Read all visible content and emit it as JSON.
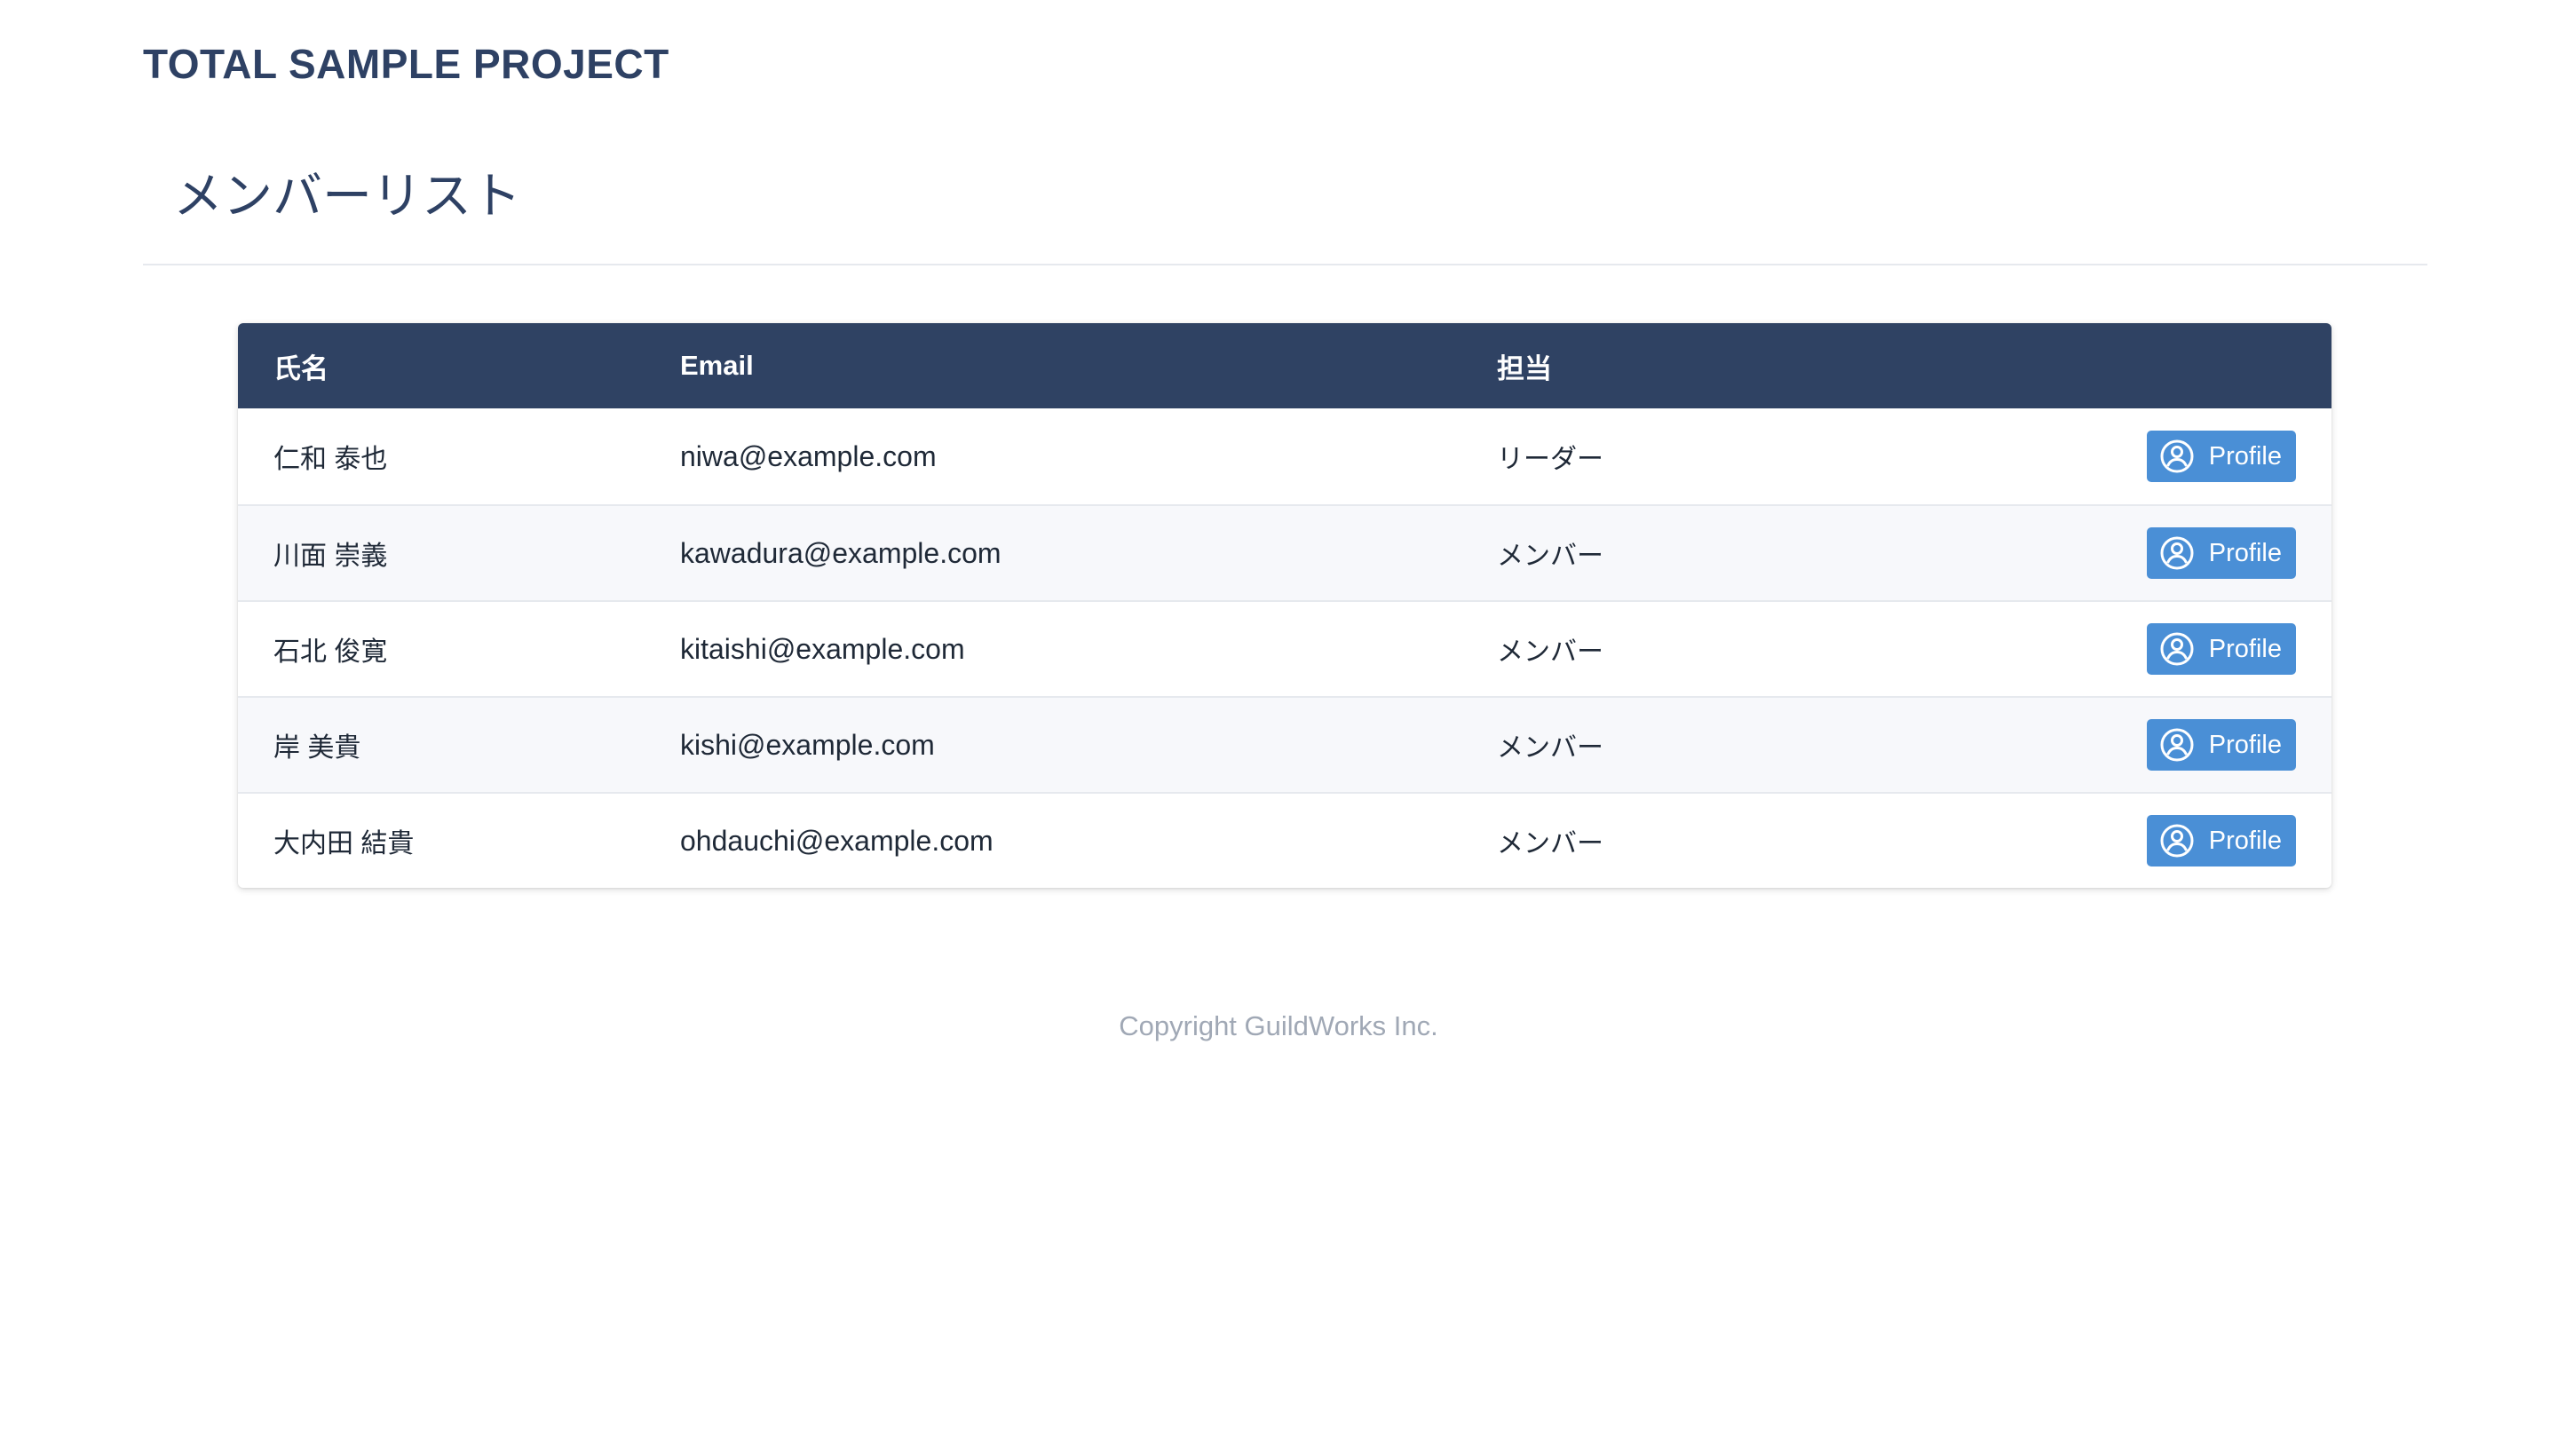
{
  "header": {
    "brand": "TOTAL SAMPLE PROJECT"
  },
  "page": {
    "title": "メンバーリスト"
  },
  "table": {
    "columns": {
      "name": "氏名",
      "email": "Email",
      "role": "担当",
      "action": ""
    },
    "rows": [
      {
        "name": "仁和 泰也",
        "email": "niwa@example.com",
        "role": "リーダー",
        "button_label": "Profile"
      },
      {
        "name": "川面 崇義",
        "email": "kawadura@example.com",
        "role": "メンバー",
        "button_label": "Profile"
      },
      {
        "name": "石北 俊寛",
        "email": "kitaishi@example.com",
        "role": "メンバー",
        "button_label": "Profile"
      },
      {
        "name": "岸 美貴",
        "email": "kishi@example.com",
        "role": "メンバー",
        "button_label": "Profile"
      },
      {
        "name": "大内田 結貴",
        "email": "ohdauchi@example.com",
        "role": "メンバー",
        "button_label": "Profile"
      }
    ],
    "button_icon": "user-circle-icon"
  },
  "footer": {
    "copyright": "Copyright GuildWorks Inc."
  },
  "colors": {
    "brand_text": "#2e4164",
    "table_header_bg": "#2f4263",
    "button_bg": "#4a8fd6",
    "row_alt_bg": "#f7f8fb",
    "footer_text": "#a0a8b5"
  }
}
